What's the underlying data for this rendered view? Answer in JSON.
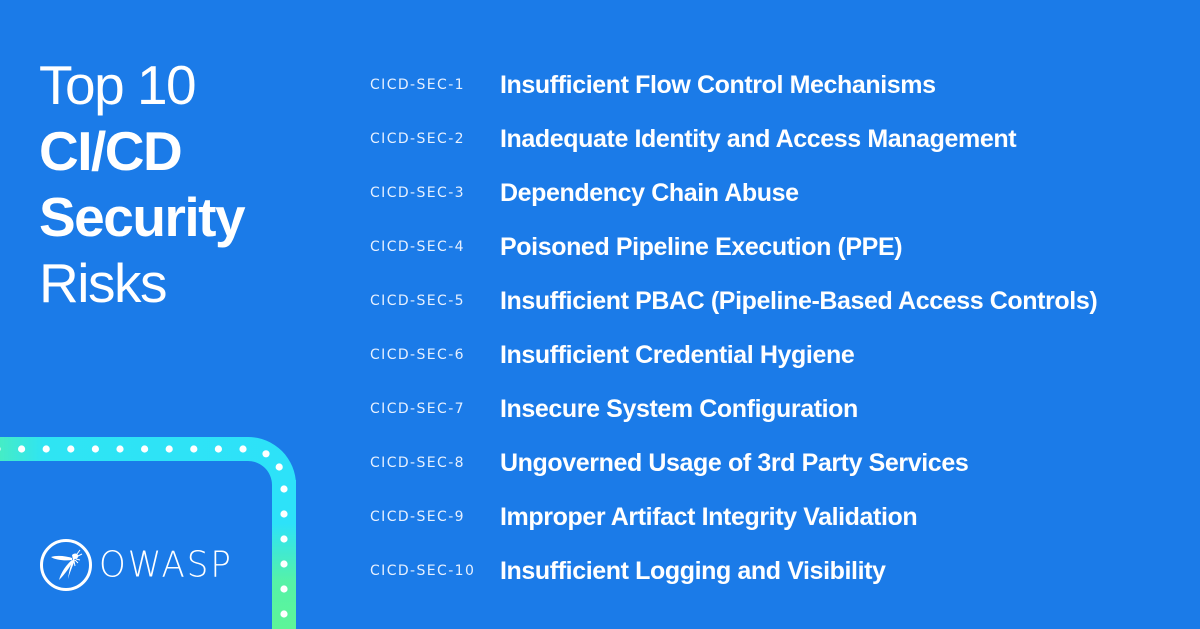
{
  "title": {
    "line1": "Top 10",
    "line2": "CI/CD",
    "line3": "Security",
    "line4": "Risks"
  },
  "risks": [
    {
      "code": "CICD-SEC-1",
      "name": "Insufficient Flow Control Mechanisms"
    },
    {
      "code": "CICD-SEC-2",
      "name": "Inadequate Identity and Access Management"
    },
    {
      "code": "CICD-SEC-3",
      "name": "Dependency Chain Abuse"
    },
    {
      "code": "CICD-SEC-4",
      "name": "Poisoned Pipeline Execution (PPE)"
    },
    {
      "code": "CICD-SEC-5",
      "name": "Insufficient PBAC (Pipeline-Based Access Controls)"
    },
    {
      "code": "CICD-SEC-6",
      "name": "Insufficient Credential Hygiene"
    },
    {
      "code": "CICD-SEC-7",
      "name": "Insecure System Configuration"
    },
    {
      "code": "CICD-SEC-8",
      "name": "Ungoverned Usage of 3rd Party Services"
    },
    {
      "code": "CICD-SEC-9",
      "name": "Improper Artifact Integrity Validation"
    },
    {
      "code": "CICD-SEC-10",
      "name": "Insufficient Logging and Visibility"
    }
  ],
  "logo": {
    "icon": "owasp-wasp-icon",
    "text": "OWASP"
  },
  "colors": {
    "background": "#1b7be8",
    "band_cyan": "#2ee3f8",
    "band_green": "#5df59a",
    "text": "#ffffff"
  }
}
